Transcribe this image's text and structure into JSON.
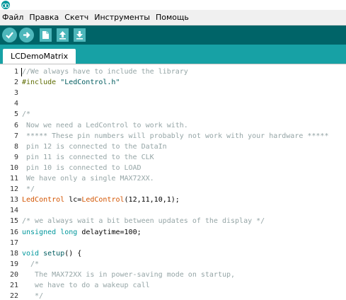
{
  "colors": {
    "toolbar": "#006468",
    "tab_strip": "#17a1a5",
    "button": "#4db7bb",
    "comment": "#95a5a6",
    "keyword": "#00979c",
    "type_red": "#d35400",
    "string": "#005c5f",
    "preprocessor": "#5e6d03",
    "plain": "#000000"
  },
  "icons": [
    "arduino-logo-icon",
    "verify-check-icon",
    "upload-arrow-icon",
    "new-file-icon",
    "open-arrow-up-icon",
    "save-arrow-down-icon"
  ],
  "menu": [
    "Файл",
    "Правка",
    "Скетч",
    "Инструменты",
    "Помощь"
  ],
  "tab": {
    "label": "LCDemoMatrix"
  },
  "lines": [
    {
      "n": "1",
      "parts": [
        {
          "t": "//We always have to include the library",
          "c": "comment"
        }
      ]
    },
    {
      "n": "2",
      "parts": [
        {
          "t": "#include ",
          "c": "preprocessor"
        },
        {
          "t": "\"LedControl.h\"",
          "c": "string"
        }
      ]
    },
    {
      "n": "3",
      "parts": []
    },
    {
      "n": "4",
      "parts": []
    },
    {
      "n": "5",
      "parts": [
        {
          "t": "/*",
          "c": "comment"
        }
      ]
    },
    {
      "n": "6",
      "parts": [
        {
          "t": " Now we need a LedControl to work with.",
          "c": "comment"
        }
      ]
    },
    {
      "n": "7",
      "parts": [
        {
          "t": " ***** These pin numbers will probably not work with your hardware *****",
          "c": "comment"
        }
      ]
    },
    {
      "n": "8",
      "parts": [
        {
          "t": " pin 12 is connected to the DataIn",
          "c": "comment"
        }
      ]
    },
    {
      "n": "9",
      "parts": [
        {
          "t": " pin 11 is connected to the CLK",
          "c": "comment"
        }
      ]
    },
    {
      "n": "10",
      "parts": [
        {
          "t": " pin 10 is connected to LOAD",
          "c": "comment"
        }
      ]
    },
    {
      "n": "11",
      "parts": [
        {
          "t": " We have only a single MAX72XX.",
          "c": "comment"
        }
      ]
    },
    {
      "n": "12",
      "parts": [
        {
          "t": " */",
          "c": "comment"
        }
      ]
    },
    {
      "n": "13",
      "parts": [
        {
          "t": "LedControl",
          "c": "type_red"
        },
        {
          "t": " lc=",
          "c": "plain"
        },
        {
          "t": "LedControl",
          "c": "type_red"
        },
        {
          "t": "(12,11,10,1);",
          "c": "plain"
        }
      ]
    },
    {
      "n": "14",
      "parts": []
    },
    {
      "n": "15",
      "parts": [
        {
          "t": "/* we always wait a bit between updates of the display */",
          "c": "comment"
        }
      ]
    },
    {
      "n": "16",
      "parts": [
        {
          "t": "unsigned",
          "c": "keyword"
        },
        {
          "t": " ",
          "c": "plain"
        },
        {
          "t": "long",
          "c": "keyword"
        },
        {
          "t": " delaytime=100;",
          "c": "plain"
        }
      ]
    },
    {
      "n": "17",
      "parts": []
    },
    {
      "n": "18",
      "parts": [
        {
          "t": "void",
          "c": "keyword"
        },
        {
          "t": " ",
          "c": "plain"
        },
        {
          "t": "setup",
          "c": "string"
        },
        {
          "t": "() {",
          "c": "plain"
        }
      ]
    },
    {
      "n": "19",
      "parts": [
        {
          "t": "  /*",
          "c": "comment"
        }
      ]
    },
    {
      "n": "20",
      "parts": [
        {
          "t": "   The MAX72XX is in power-saving mode on startup,",
          "c": "comment"
        }
      ]
    },
    {
      "n": "21",
      "parts": [
        {
          "t": "   we have to do a wakeup call",
          "c": "comment"
        }
      ]
    },
    {
      "n": "22",
      "parts": [
        {
          "t": "   */",
          "c": "comment"
        }
      ]
    }
  ]
}
